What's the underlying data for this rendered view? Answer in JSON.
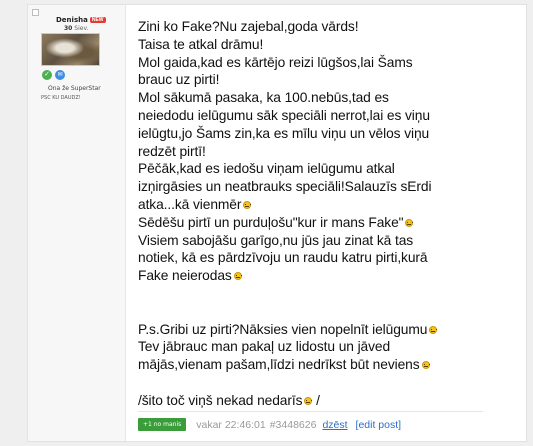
{
  "user": {
    "name": "Denisha",
    "badge": "NEW",
    "age_number": "30",
    "age_unit": "Siev.",
    "rank": "Ona že SuperStar",
    "signature": "PSC KU DAUDZ!"
  },
  "post": {
    "lines": [
      {
        "text": "Zini ko Fake?Nu zajebal,goda vārds!",
        "smiley": false
      },
      {
        "text": "Taisa te atkal drāmu!",
        "smiley": false
      },
      {
        "text": "Mol gaida,kad es kārtējo reizi lūgšos,lai Šams",
        "smiley": false
      },
      {
        "text": "brauc uz pirti!",
        "smiley": false
      },
      {
        "text": "Mol sākumā pasaka, ka 100.nebūs,tad es",
        "smiley": false
      },
      {
        "text": "neiedodu ielūgumu sāk speciāli nerrot,lai es viņu",
        "smiley": false
      },
      {
        "text": "ielūgtu,jo Šams zin,ka es mīlu viņu un vēlos viņu",
        "smiley": false
      },
      {
        "text": "redzēt pirtī!",
        "smiley": false
      },
      {
        "text": "Pēčāk,kad es iedošu viņam ielūgumu atkal",
        "smiley": false
      },
      {
        "text": "izņirgāsies un neatbrauks speciāli!Salauzīs sErdi",
        "smiley": false
      },
      {
        "text": "atka...kā vienmēr",
        "smiley": true
      },
      {
        "text": "Sēdēšu pirtī un purduļošu\"kur ir mans Fake\"",
        "smiley": true
      },
      {
        "text": "Visiem sabojāšu garīgo,nu jūs jau zinat kā tas",
        "smiley": false
      },
      {
        "text": "notiek, kā es pārdzīvoju un raudu katru pirti,kurā",
        "smiley": false
      },
      {
        "text": "Fake neierodas",
        "smiley": true
      },
      {
        "text": "",
        "smiley": false
      },
      {
        "text": "",
        "smiley": false
      },
      {
        "text": "P.s.Gribi uz pirti?Nāksies vien nopelnīt ielūgumu",
        "smiley": true
      },
      {
        "text": "Tev jābrauc man pakaļ uz lidostu un jāved",
        "smiley": false
      },
      {
        "text": "mājās,vienam pašam,līdzi nedrīkst būt neviens",
        "smiley": true
      },
      {
        "text": "",
        "smiley": false
      },
      {
        "text": "/šito toč viņš nekad nedarīs",
        "smiley": true,
        "after": " /"
      }
    ]
  },
  "footer": {
    "plus_label": "+1 no manis",
    "timestamp": "vakar 22:46:01",
    "post_id": "#3448626",
    "delete_label": "dzēst",
    "edit_label": "[edit post]"
  },
  "colors": {
    "accent_green": "#3a9d3a",
    "link_blue": "#2a6fc9",
    "badge_red": "#e53935"
  }
}
